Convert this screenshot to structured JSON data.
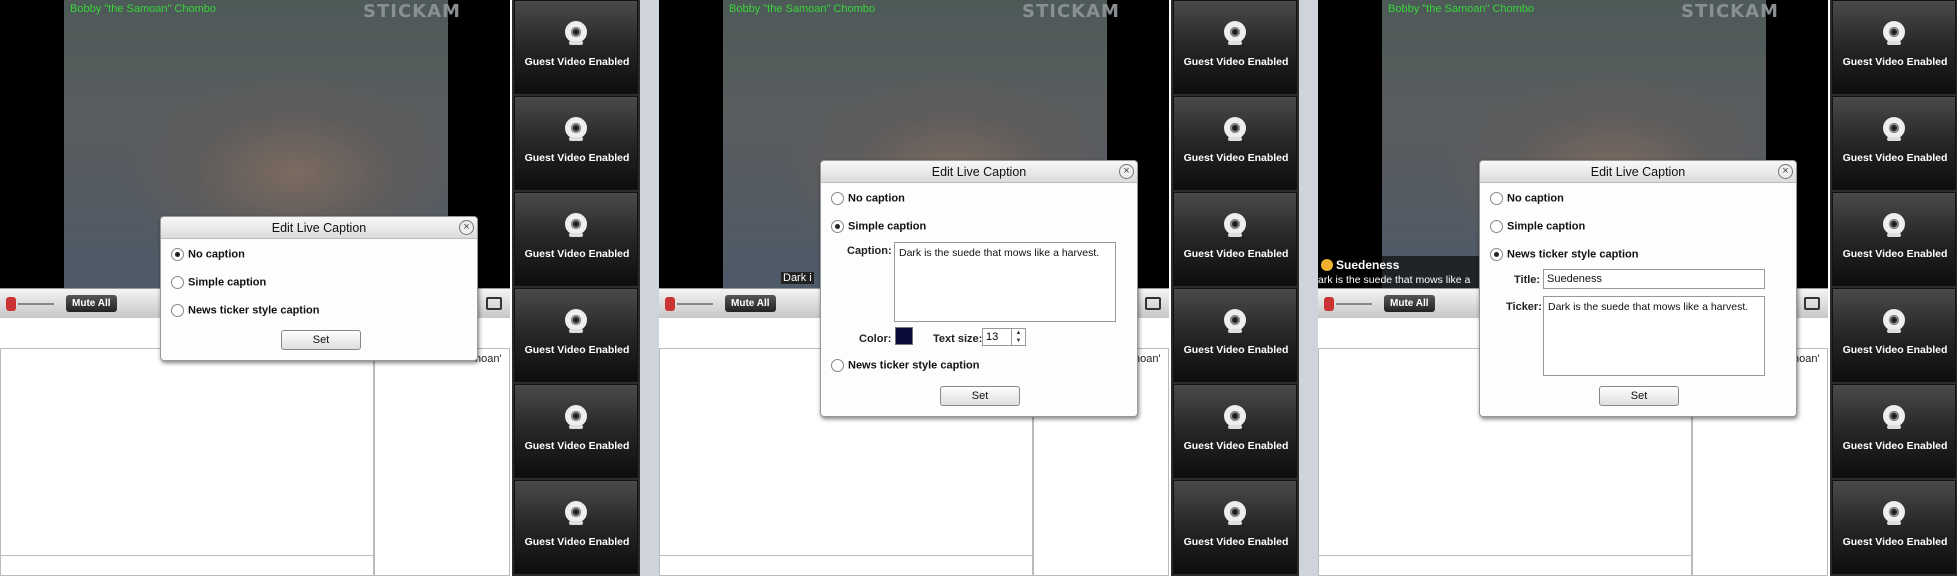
{
  "stream": {
    "username": "Bobby \"the Samoan\" Chombo",
    "logo": "STICKAM",
    "mute_all": "Mute All",
    "user_in_list": "hoan'"
  },
  "guest_tile_label": "Guest Video Enabled",
  "dialog": {
    "title": "Edit Live Caption",
    "close": "×",
    "opt_none": "No caption",
    "opt_simple": "Simple caption",
    "opt_news": "News ticker style caption",
    "set": "Set"
  },
  "panel2": {
    "caption_label": "Caption:",
    "caption_value": "Dark is the suede that mows like a harvest.",
    "color_label": "Color:",
    "color_value": "#0b0b3a",
    "text_size_label": "Text size:",
    "text_size_value": "13",
    "overlay_caption": "Dark i"
  },
  "panel3": {
    "title_label": "Title:",
    "title_value": "Suedeness",
    "ticker_label": "Ticker:",
    "ticker_value": "Dark is the suede that mows like a harvest.",
    "overlay_title": "Suedeness",
    "overlay_ticker": "ark is the suede that mows like a"
  }
}
